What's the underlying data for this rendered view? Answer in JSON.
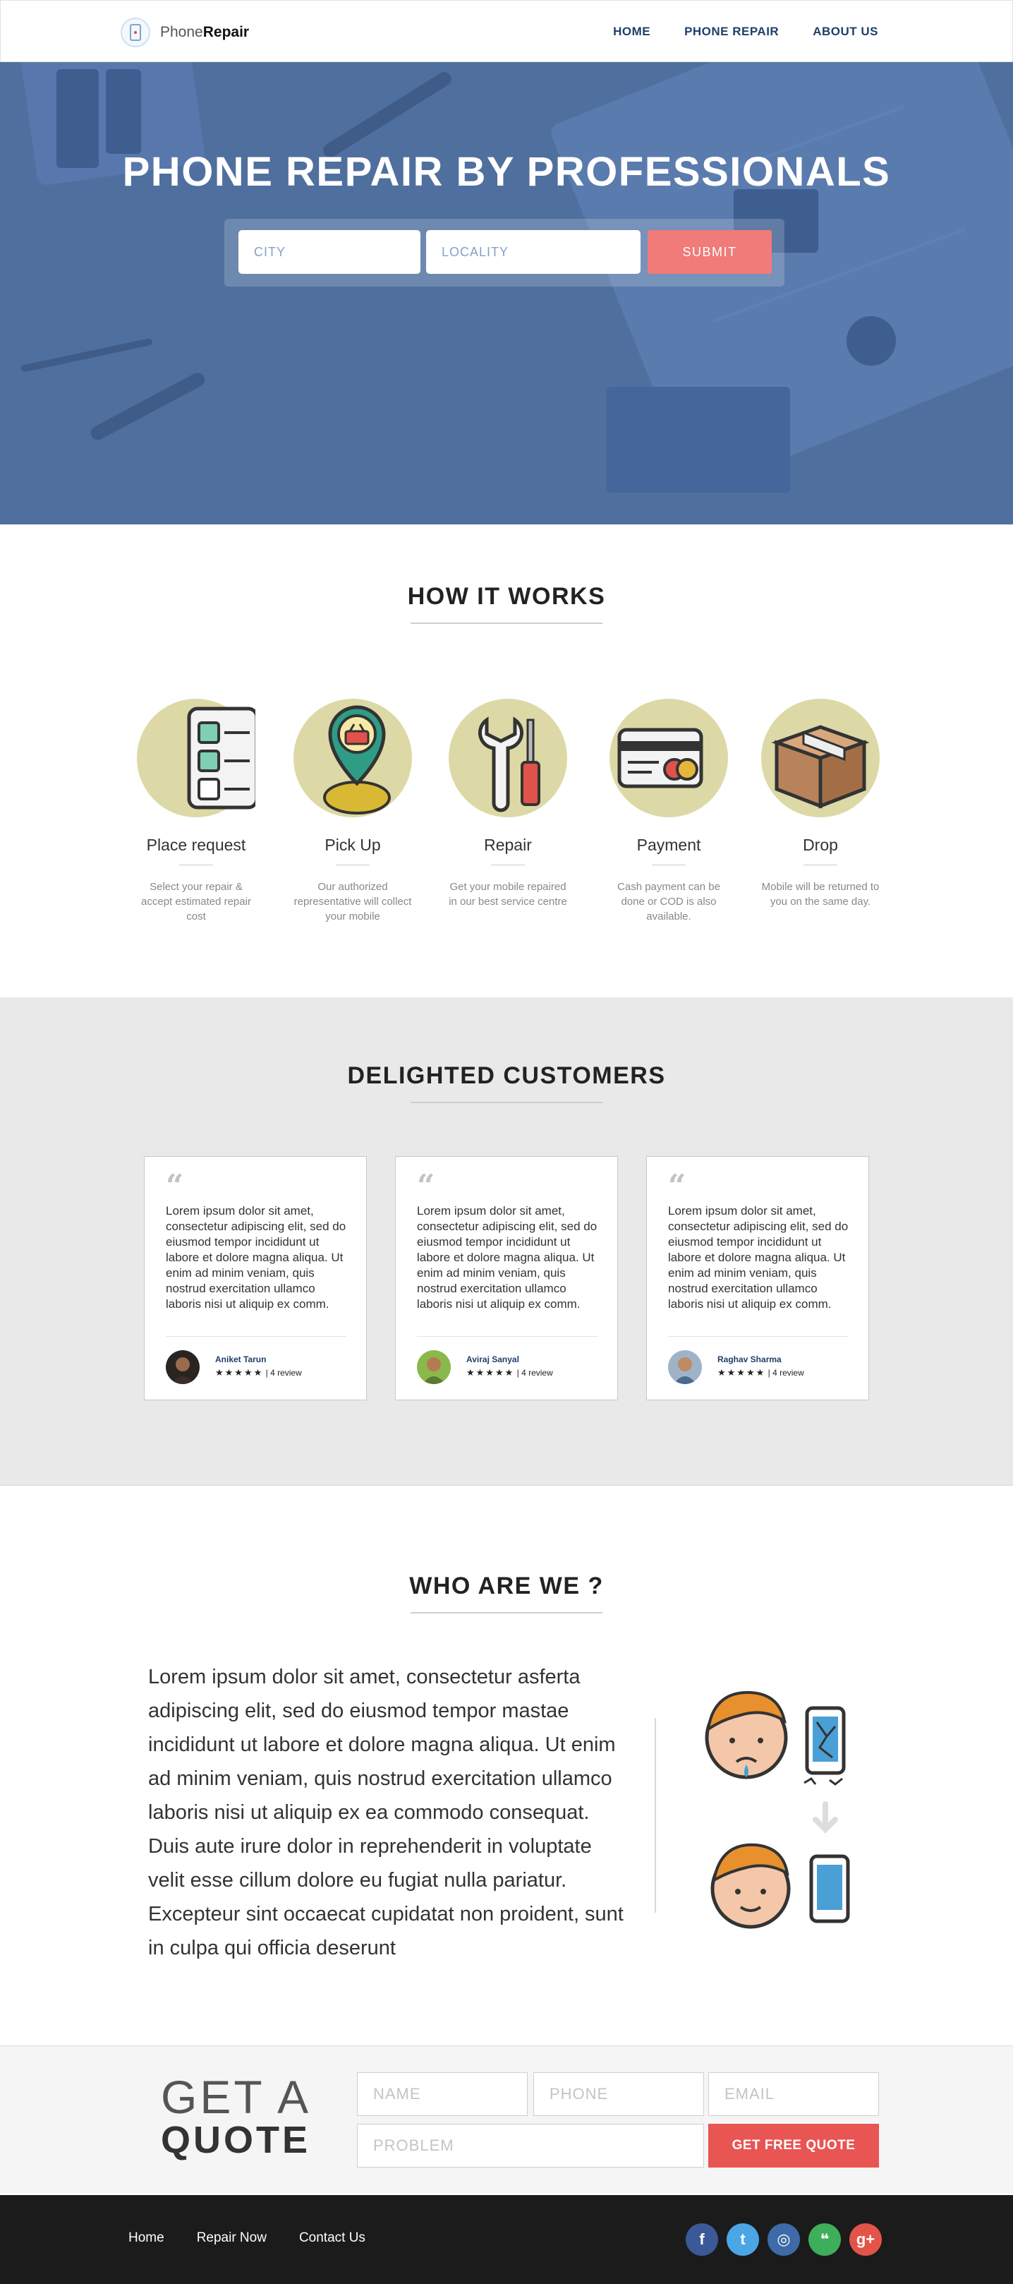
{
  "nav": {
    "logo_light": "Phone",
    "logo_bold": "Repair",
    "links": [
      "HOME",
      "PHONE REPAIR",
      "ABOUT US"
    ]
  },
  "hero": {
    "title": "PHONE REPAIR BY PROFESSIONALS",
    "city_placeholder": "CITY",
    "locality_placeholder": "LOCALITY",
    "submit_label": "SUBMIT"
  },
  "how": {
    "title": "HOW IT WORKS",
    "steps": [
      {
        "name": "Place request",
        "desc": "Select your repair & accept estimated repair cost",
        "icon": "checklist-icon"
      },
      {
        "name": "Pick Up",
        "desc": "Our authorized representative will collect your mobile",
        "icon": "map-pin-basket-icon"
      },
      {
        "name": "Repair",
        "desc": "Get your mobile repaired in our best service centre",
        "icon": "wrench-screwdriver-icon"
      },
      {
        "name": "Payment",
        "desc": "Cash payment can be done or COD is also available.",
        "icon": "credit-card-icon"
      },
      {
        "name": "Drop",
        "desc": "Mobile will be returned to you on the same day.",
        "icon": "box-icon"
      }
    ]
  },
  "customers": {
    "title": "DELIGHTED CUSTOMERS",
    "reviews": [
      {
        "text": "Lorem ipsum dolor sit amet, consectetur adipiscing elit, sed do eiusmod tempor incididunt ut labore et dolore magna aliqua. Ut enim ad minim veniam, quis nostrud exercitation ullamco laboris nisi ut aliquip ex comm.",
        "name": "Aniket Tarun",
        "stars": "★★★★★",
        "count": "| 4 review"
      },
      {
        "text": "Lorem ipsum dolor sit amet, consectetur adipiscing elit, sed do eiusmod tempor incididunt ut labore et dolore magna aliqua. Ut enim ad minim veniam, quis nostrud exercitation ullamco laboris nisi ut aliquip ex comm.",
        "name": "Aviraj Sanyal",
        "stars": "★★★★★",
        "count": "| 4 review"
      },
      {
        "text": "Lorem ipsum dolor sit amet, consectetur adipiscing elit, sed do eiusmod tempor incididunt ut labore et dolore magna aliqua. Ut enim ad minim veniam, quis nostrud exercitation ullamco laboris nisi ut aliquip ex comm.",
        "name": "Raghav Sharma",
        "stars": "★★★★★",
        "count": "| 4 review"
      }
    ]
  },
  "about": {
    "title": "WHO ARE WE ?",
    "text": "Lorem ipsum dolor sit amet, consectetur asferta adipiscing elit, sed do eiusmod tempor mastae incididunt ut labore et dolore magna aliqua. Ut enim ad minim veniam, quis nostrud exercitation ullamco laboris nisi ut aliquip ex ea commodo consequat. Duis aute irure dolor in reprehenderit in voluptate velit esse cillum dolore eu fugiat nulla pariatur. Excepteur sint occaecat cupidatat non proident, sunt in culpa qui officia deserunt"
  },
  "quote": {
    "line1": "GET A",
    "line2": "QUOTE",
    "name_placeholder": "NAME",
    "phone_placeholder": "PHONE",
    "email_placeholder": "EMAIL",
    "problem_placeholder": "PROBLEM",
    "button_label": "GET FREE QUOTE"
  },
  "footer": {
    "links": [
      "Home",
      "Repair Now",
      "Contact Us"
    ],
    "social": [
      {
        "icon": "facebook-icon",
        "glyph": "f",
        "color": "#3b5998"
      },
      {
        "icon": "twitter-icon",
        "glyph": "t",
        "color": "#4ba6e6"
      },
      {
        "icon": "instagram-icon",
        "glyph": "◎",
        "color": "#3d6ba8"
      },
      {
        "icon": "hangouts-icon",
        "glyph": "❝",
        "color": "#3fae5a"
      },
      {
        "icon": "google-plus-icon",
        "glyph": "g+",
        "color": "#e4534a"
      }
    ]
  },
  "colors": {
    "accent": "#e85553",
    "hero_blue": "#4f6f9e",
    "step_circle": "#ddd9a6",
    "nav_link": "#1f3f6b"
  }
}
